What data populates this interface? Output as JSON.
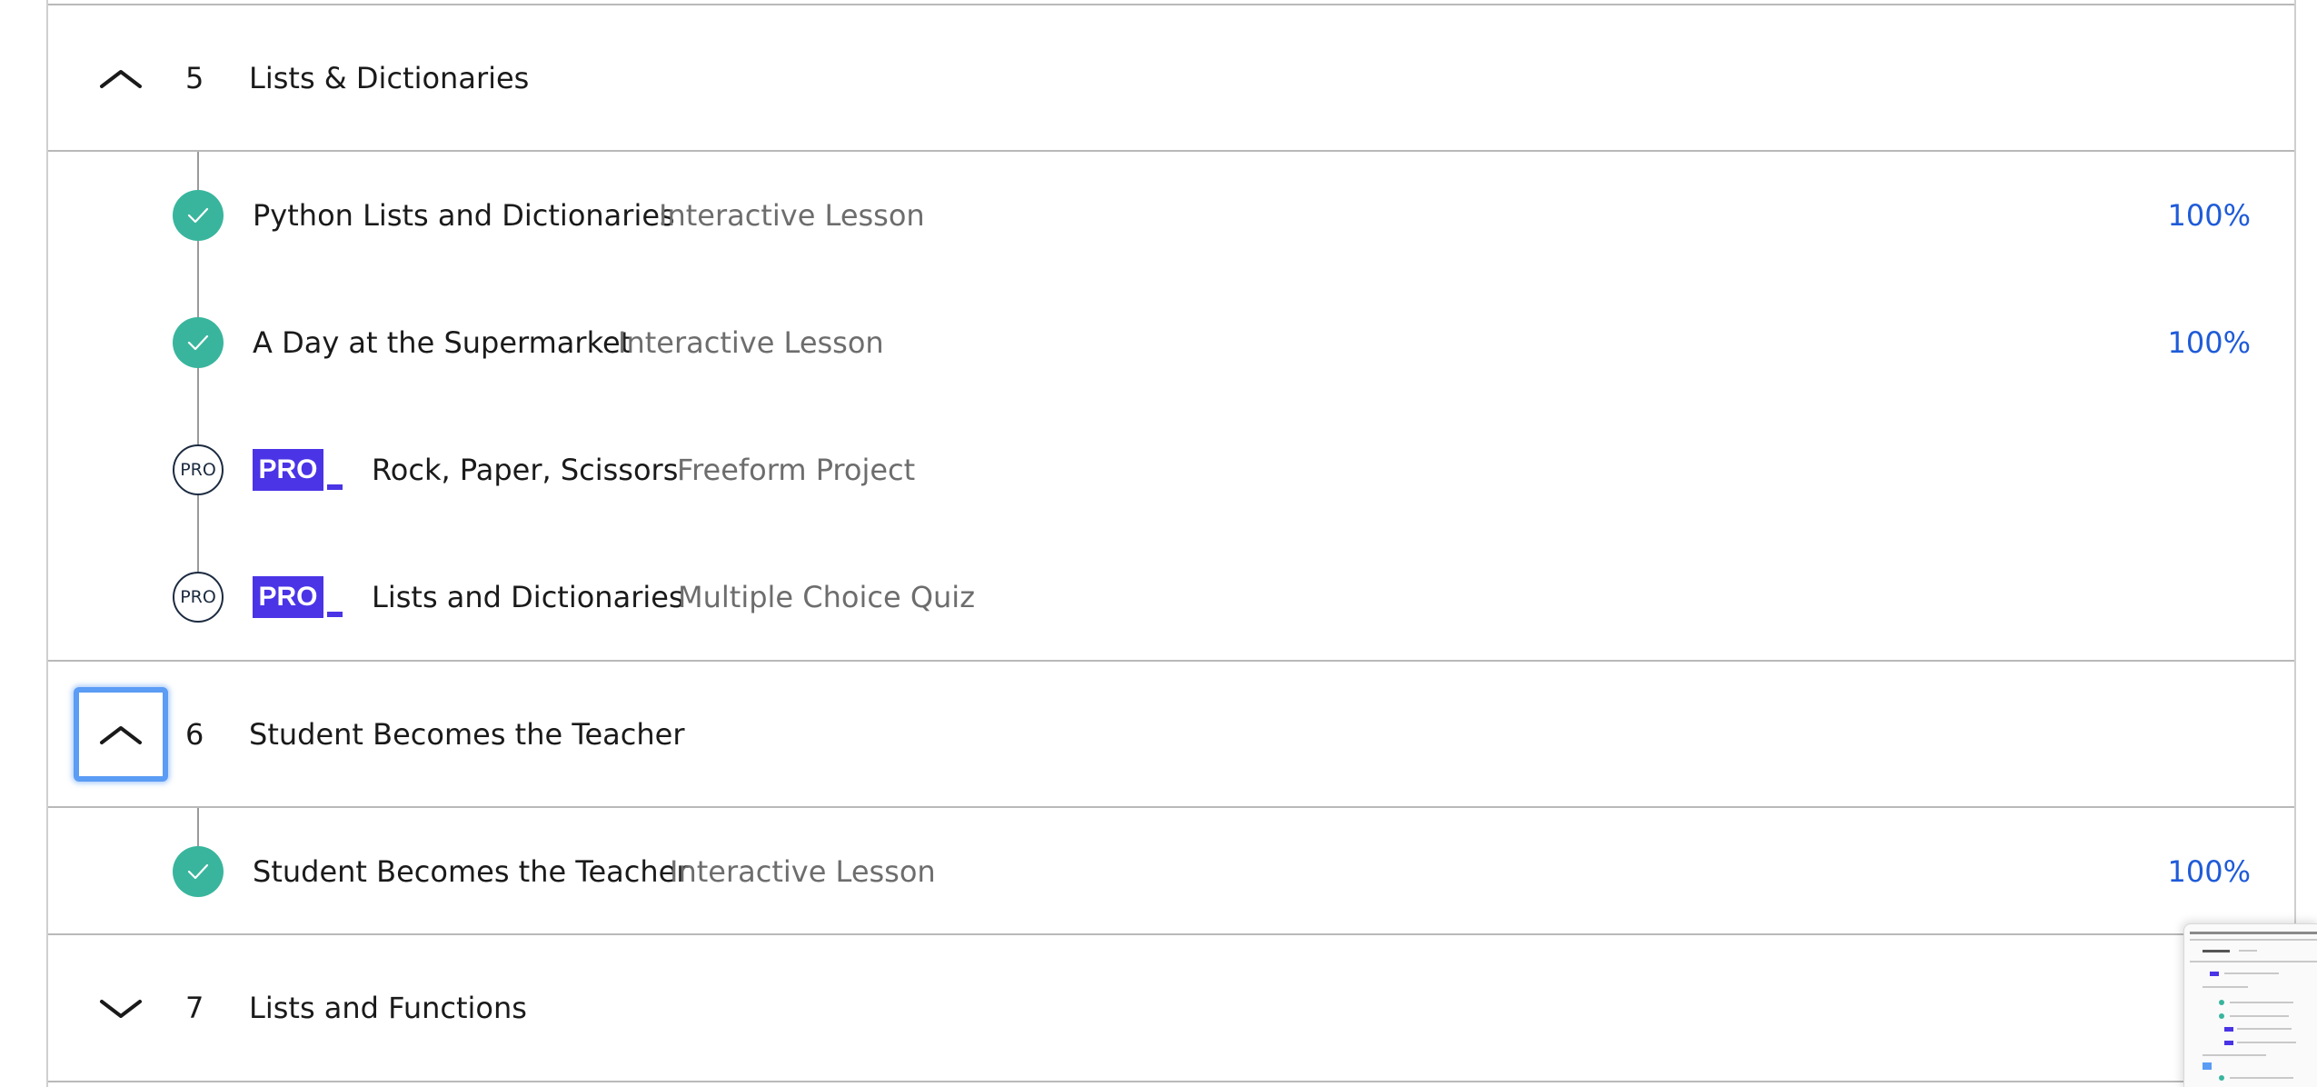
{
  "sections": [
    {
      "number": "5",
      "title": "Lists & Dictionaries",
      "expanded": true,
      "lessons": [
        {
          "title": "Python Lists and Dictionaries",
          "type": "Interactive Lesson",
          "status": "complete",
          "progress": "100%"
        },
        {
          "title": "A Day at the Supermarket",
          "type": "Interactive Lesson",
          "status": "complete",
          "progress": "100%"
        },
        {
          "title": "Rock, Paper, Scissors",
          "type": "Freeform Project",
          "status": "pro",
          "pro_label": "PRO",
          "badge_label": "PRO"
        },
        {
          "title": "Lists and Dictionaries",
          "type": "Multiple Choice Quiz",
          "status": "pro",
          "pro_label": "PRO",
          "badge_label": "PRO"
        }
      ]
    },
    {
      "number": "6",
      "title": "Student Becomes the Teacher",
      "expanded": true,
      "focused": true,
      "lessons": [
        {
          "title": "Student Becomes the Teacher",
          "type": "Interactive Lesson",
          "status": "complete",
          "progress": "100%"
        }
      ]
    },
    {
      "number": "7",
      "title": "Lists and Functions",
      "expanded": false,
      "lessons": []
    }
  ],
  "colors": {
    "complete": "#39b59d",
    "pro_badge": "#4a34e6",
    "progress_text": "#1f5bd8",
    "focus_ring": "#5b9cf5"
  },
  "icons": {
    "expanded": "chevron-up-icon",
    "collapsed": "chevron-down-icon",
    "complete": "checkmark-icon"
  }
}
